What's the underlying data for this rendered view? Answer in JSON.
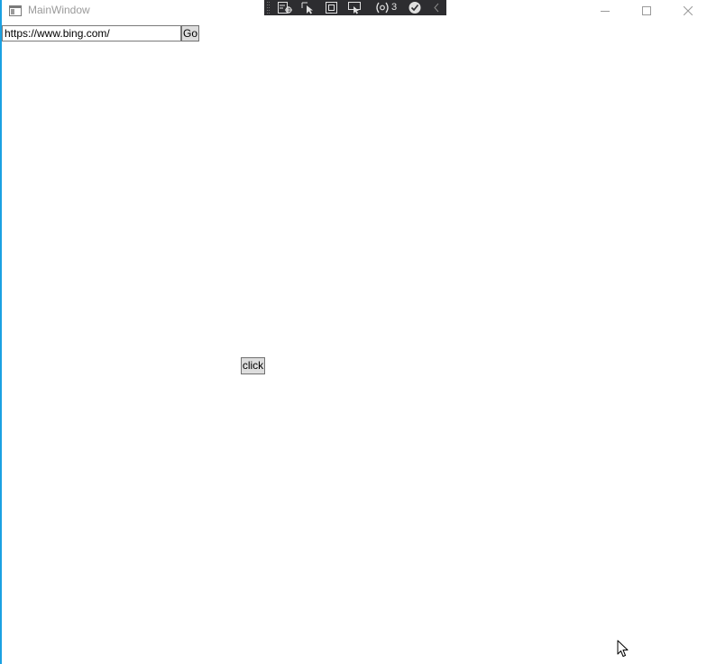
{
  "window": {
    "title": "MainWindow"
  },
  "caption_buttons": {
    "minimize_icon": "minimize-icon",
    "maximize_icon": "maximize-icon",
    "close_icon": "close-icon"
  },
  "debug_toolbar": {
    "icons": [
      "go-to-live-visual-tree-icon",
      "select-element-icon",
      "display-layout-adorners-icon",
      "track-focused-element-icon",
      "binding-failures-icon",
      "hot-reload-status-icon",
      "collapse-toolbar-icon"
    ],
    "binding_failures_count": "3"
  },
  "address_bar": {
    "url_value": "https://www.bing.com/",
    "go_label": "Go"
  },
  "content": {
    "click_label": "click"
  },
  "colors": {
    "window_border": "#1ba1e2",
    "toolbar_background": "#2d2d30",
    "button_background": "#dddddd",
    "title_text": "#9a9a9a"
  }
}
